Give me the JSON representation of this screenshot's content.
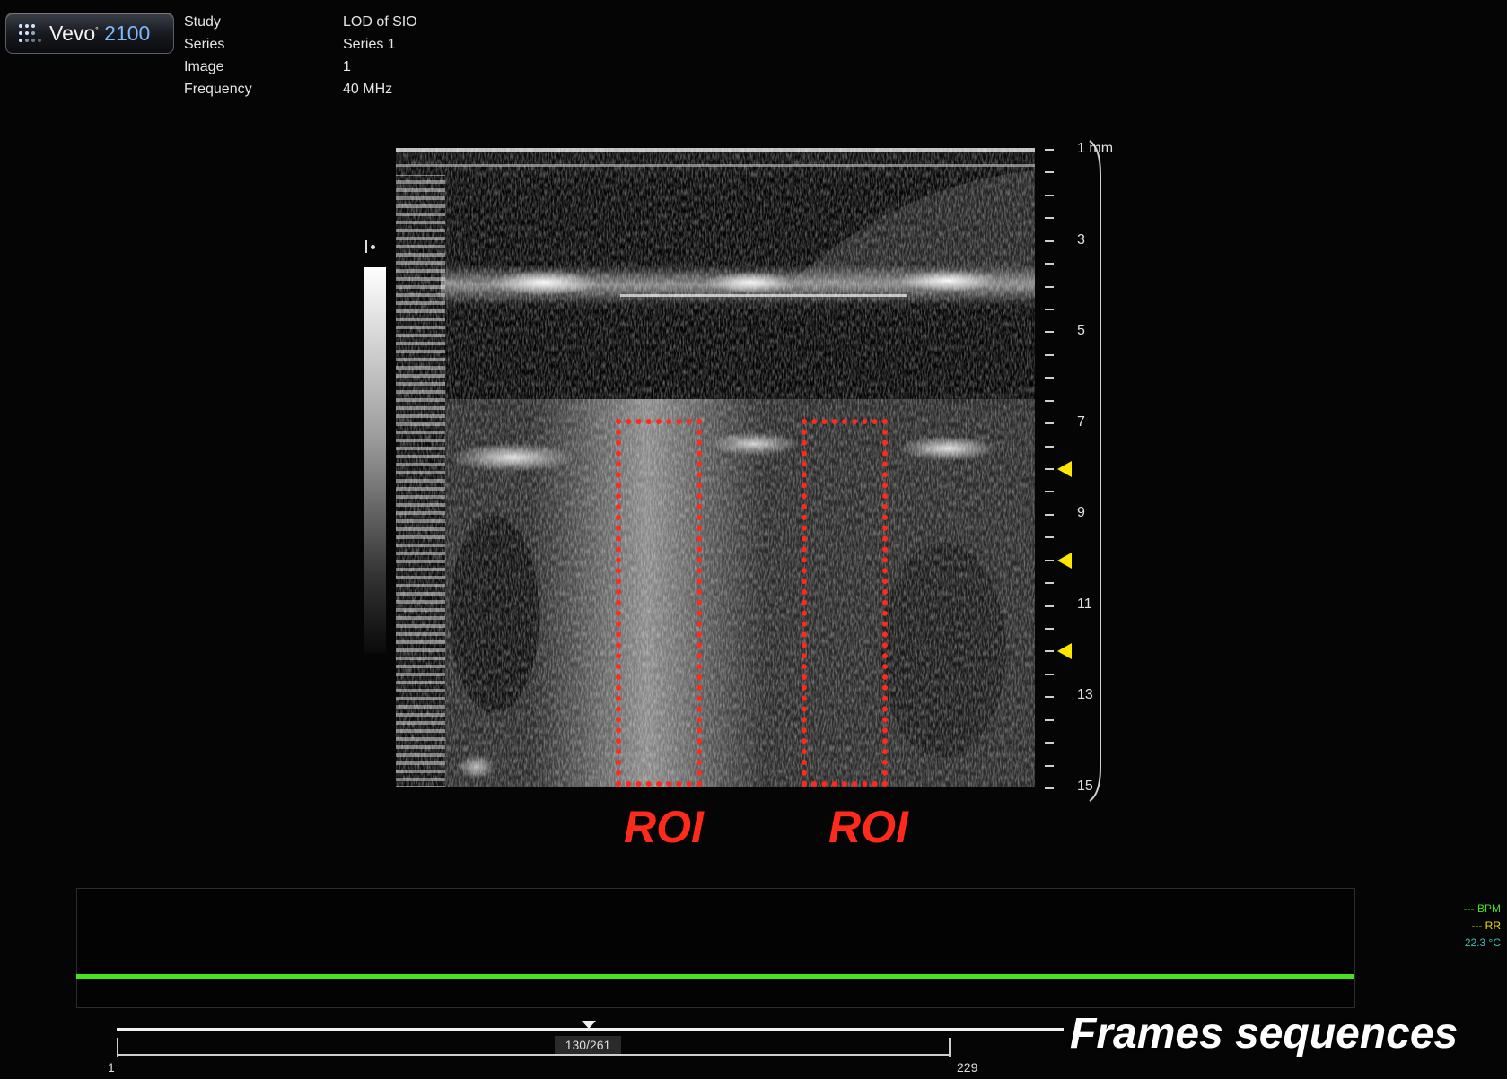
{
  "logo": {
    "brand": "Vevo",
    "model": "2100"
  },
  "study_info": [
    {
      "label": "Study",
      "value": "LOD of SIO"
    },
    {
      "label": "Series",
      "value": "Series 1"
    },
    {
      "label": "Image",
      "value": "1"
    },
    {
      "label": "Frequency",
      "value": "40 MHz"
    }
  ],
  "depth_scale": {
    "unit": "mm",
    "labels": [
      "1",
      "3",
      "5",
      "7",
      "9",
      "11",
      "13",
      "15"
    ],
    "focus_marker_depths_mm": [
      8,
      10,
      12
    ],
    "focus_color": "#ffe600"
  },
  "roi": {
    "labels": [
      "ROI",
      "ROI"
    ],
    "color": "#ff2a1a"
  },
  "physio": {
    "bpm_label": "--- BPM",
    "rr_label": "--- RR",
    "temperature": "22.3 °C",
    "line_color": "#49e01c"
  },
  "timeline": {
    "frame_counter": "130/261",
    "range_start": "1",
    "range_end": "229",
    "caption": "Frames sequences"
  }
}
